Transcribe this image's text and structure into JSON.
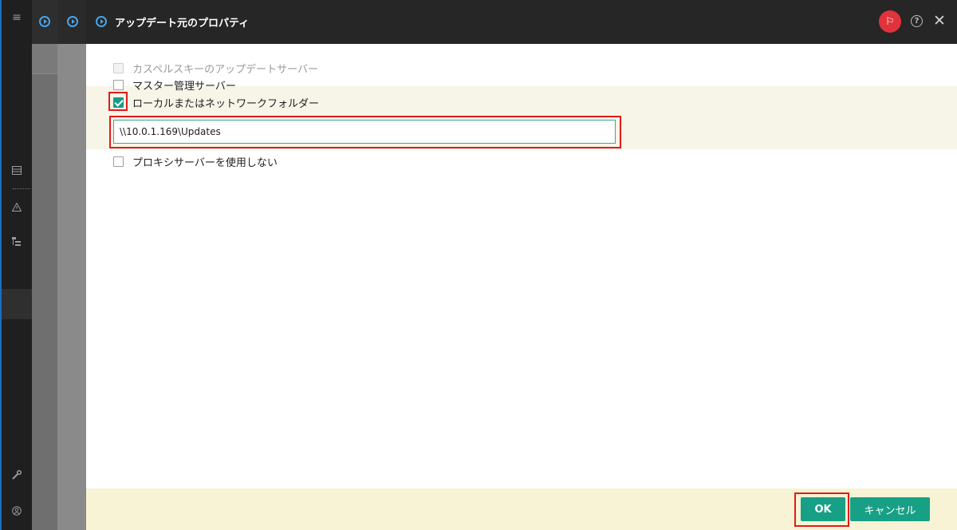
{
  "dialog": {
    "title": "アップデート元のプロパティ"
  },
  "options": [
    {
      "label": "カスペルスキーのアップデートサーバー",
      "checked": false,
      "disabled": true
    },
    {
      "label": "マスター管理サーバー",
      "checked": false,
      "disabled": false
    },
    {
      "label": "ローカルまたはネットワークフォルダー",
      "checked": true,
      "disabled": false
    },
    {
      "label": "プロキシサーバーを使用しない",
      "checked": false,
      "disabled": false
    }
  ],
  "folder_path": {
    "value": "\\\\10.0.1.169\\Updates"
  },
  "buttons": {
    "ok": "OK",
    "cancel": "キャンセル"
  },
  "icons": {
    "menu": "≡",
    "flag": "⚐",
    "help": "?",
    "close": "✕"
  },
  "colors": {
    "accent": "#17a085",
    "flag": "#e0333c",
    "highlight_box": "#e01b1b"
  }
}
